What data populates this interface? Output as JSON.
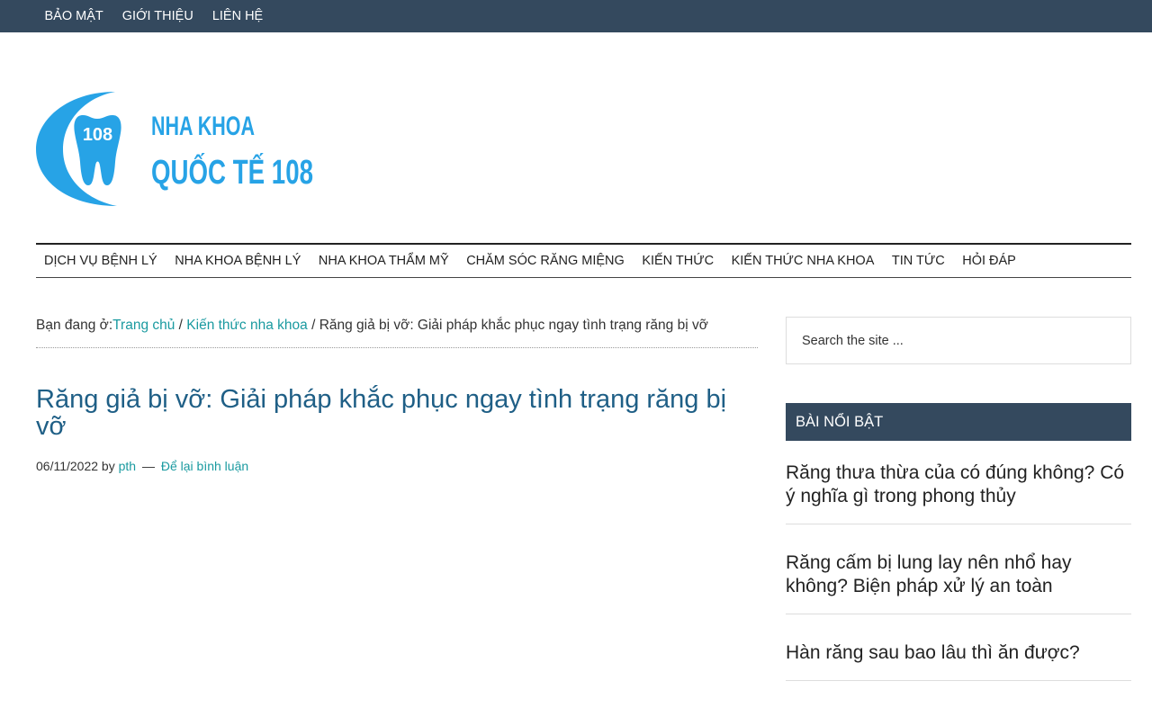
{
  "topbar": {
    "links": [
      "BẢO MẬT",
      "GIỚI THIỆU",
      "LIÊN HỆ"
    ]
  },
  "logo": {
    "badge_text": "108",
    "line1": "NHA KHOA",
    "line2": "QUỐC TẾ 108",
    "brand_color": "#27a3e6"
  },
  "main_nav": {
    "items": [
      "DỊCH VỤ BỆNH LÝ",
      "NHA KHOA BỆNH LÝ",
      "NHA KHOA THẨM MỸ",
      "CHĂM SÓC RĂNG MIỆNG",
      "KIẾN THỨC",
      "KIẾN THỨC NHA KHOA",
      "TIN TỨC",
      "HỎI ĐÁP"
    ]
  },
  "breadcrumb": {
    "prefix": "Bạn đang ở:",
    "home": "Trang chủ",
    "sep": " / ",
    "category": "Kiến thức nha khoa",
    "current": "Răng giả bị vỡ: Giải pháp khắc phục ngay tình trạng răng bị vỡ"
  },
  "post": {
    "title": "Răng giả bị vỡ: Giải pháp khắc phục ngay tình trạng răng bị vỡ",
    "date": "06/11/2022",
    "by": "by",
    "author": "pth",
    "dash": "—",
    "comment_link": "Để lại bình luận"
  },
  "sidebar": {
    "search_placeholder": "Search the site ...",
    "widget_title": "BÀI NỔI BẬT",
    "featured": [
      "Răng thưa thừa của có đúng không? Có ý nghĩa gì trong phong thủy",
      "Răng cấm bị lung lay nên nhổ hay không? Biện pháp xử lý an toàn",
      "Hàn răng sau bao lâu thì ăn được?"
    ]
  },
  "colors": {
    "topbar_bg": "#34495e",
    "link": "#1a9aa0",
    "title": "#1f5f86"
  }
}
